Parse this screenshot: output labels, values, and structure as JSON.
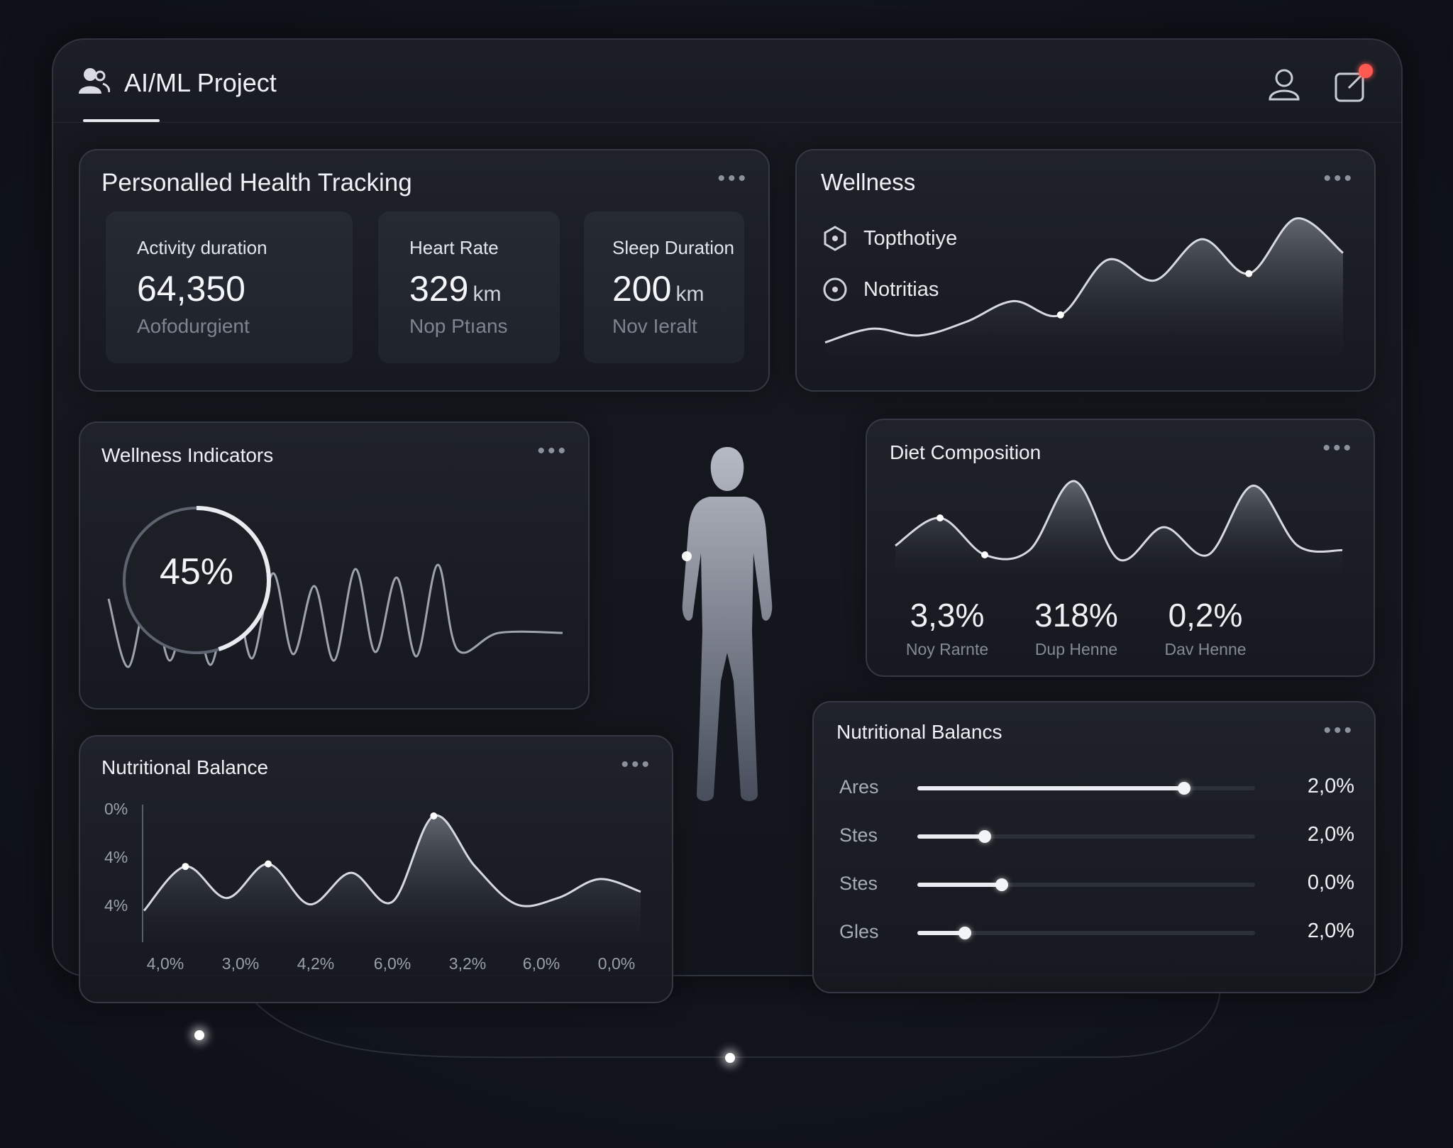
{
  "app": {
    "title": "AI/ML Project"
  },
  "header": {
    "user_icon": "user-icon",
    "share_icon": "share-icon",
    "notification_color": "#ff5a52"
  },
  "health_tracking": {
    "title": "Personalled Health Tracking",
    "metrics": [
      {
        "label": "Activity duration",
        "value": "64,350",
        "unit": "",
        "sub": "Aofodurgient"
      },
      {
        "label": "Heart Rate",
        "value": "329",
        "unit": "km",
        "sub": "Nop Ptıans"
      },
      {
        "label": "Sleep Duration",
        "value": "200",
        "unit": "km",
        "sub": "Nov Ieralt"
      }
    ]
  },
  "wellness": {
    "title": "Wellness",
    "legend": [
      {
        "icon": "shield-icon",
        "label": "Topthotiye"
      },
      {
        "icon": "target-icon",
        "label": "Notritias"
      }
    ]
  },
  "wellness_indicators": {
    "title": "Wellness Indicators",
    "percent_label": "45%",
    "progress": 0.45
  },
  "diet_composition": {
    "title": "Diet Composition",
    "stats": [
      {
        "value": "3,3%",
        "label": "Noy Rarnte"
      },
      {
        "value": "318%",
        "label": "Dup Henne"
      },
      {
        "value": "0,2%",
        "label": "Dav Henne"
      }
    ]
  },
  "nutritional_balance_chart": {
    "title": "Nutritional Balance",
    "y_ticks": [
      "0%",
      "4%",
      "4%"
    ],
    "x_ticks": [
      "4,0%",
      "3,0%",
      "4,2%",
      "6,0%",
      "3,2%",
      "6,0%",
      "0,0%"
    ]
  },
  "nutritional_balancs": {
    "title": "Nutritional Balancs",
    "rows": [
      {
        "label": "Ares",
        "value": "2,0%",
        "fill": 0.79
      },
      {
        "label": "Stes",
        "value": "2,0%",
        "fill": 0.2
      },
      {
        "label": "Stes",
        "value": "0,0%",
        "fill": 0.25
      },
      {
        "label": "Gles",
        "value": "2,0%",
        "fill": 0.14
      }
    ]
  },
  "chart_data": [
    {
      "type": "area",
      "title": "Nutritional Balance",
      "x": [
        "4,0%",
        "3,0%",
        "4,2%",
        "6,0%",
        "3,2%",
        "6,0%",
        "0,0%"
      ],
      "y_ticks": [
        "0%",
        "4%",
        "4%"
      ],
      "series": [
        {
          "values": [
            0.2,
            0.6,
            0.3,
            0.55,
            0.3,
            1.0,
            0.45
          ]
        }
      ],
      "grid": false
    },
    {
      "type": "area",
      "title": "Wellness",
      "series": [
        {
          "name": "Topthotiye",
          "values": [
            0.1,
            0.2,
            0.15,
            0.25,
            0.4,
            0.3,
            0.7,
            0.55,
            0.85,
            0.6,
            1.0,
            0.75
          ]
        }
      ]
    },
    {
      "type": "area",
      "title": "Diet Composition",
      "series": [
        {
          "values": [
            0.3,
            0.6,
            0.2,
            0.25,
            1.0,
            0.15,
            0.5,
            0.2,
            0.95,
            0.3,
            0.25
          ]
        }
      ]
    }
  ]
}
